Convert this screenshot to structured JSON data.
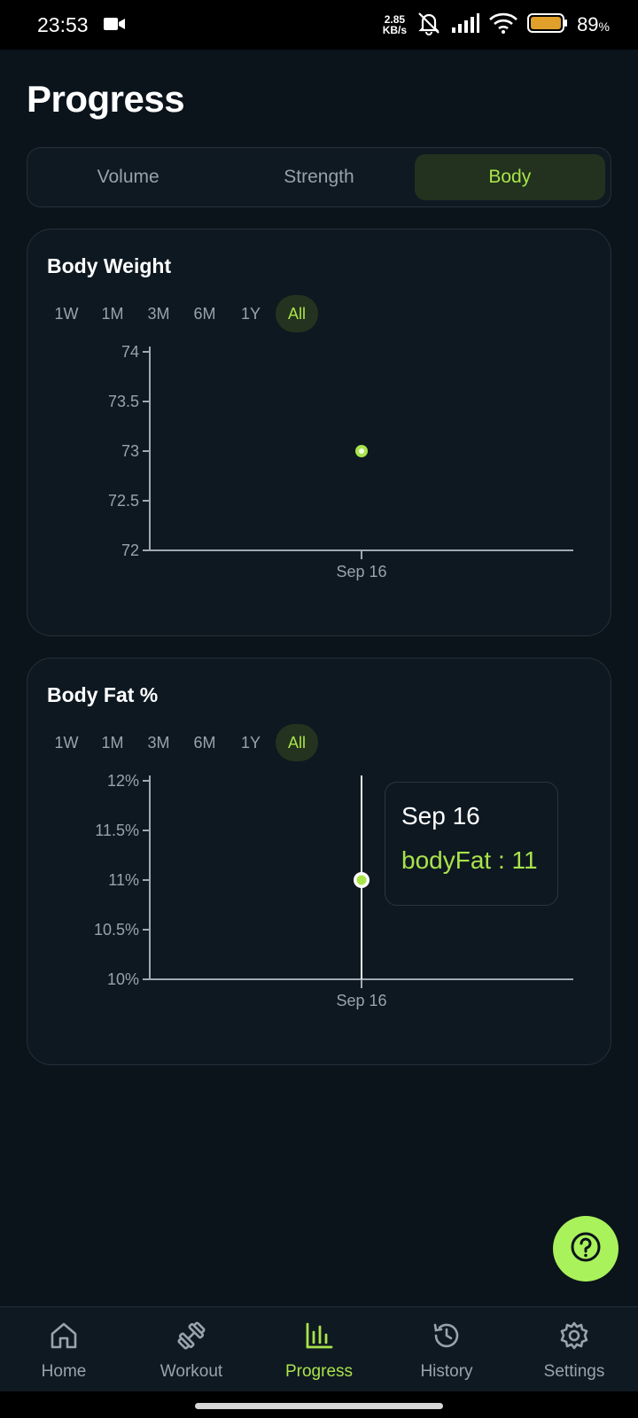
{
  "status_bar": {
    "time": "23:53",
    "net_speed_value": "2.85",
    "net_speed_unit": "KB/s",
    "battery_percent": "89",
    "percent_sign": "%",
    "icons": [
      "video-camera-icon",
      "mute-bell-icon",
      "signal-icon",
      "wifi-icon",
      "battery-icon"
    ]
  },
  "page": {
    "title": "Progress"
  },
  "tabs": [
    {
      "label": "Volume",
      "active": false
    },
    {
      "label": "Strength",
      "active": false
    },
    {
      "label": "Body",
      "active": true
    }
  ],
  "ranges": [
    "1W",
    "1M",
    "3M",
    "6M",
    "1Y",
    "All"
  ],
  "active_range": "All",
  "cards": {
    "weight_title": "Body Weight",
    "fat_title": "Body Fat %"
  },
  "tooltip": {
    "date": "Sep 16",
    "text": "bodyFat : 11"
  },
  "chart_data": [
    {
      "type": "scatter",
      "title": "Body Weight",
      "x": [
        "Sep 16"
      ],
      "y": [
        73
      ],
      "yticks": [
        "74",
        "73.5",
        "73",
        "72.5",
        "72"
      ],
      "ytick_values": [
        74,
        73.5,
        73,
        72.5,
        72
      ],
      "ylim": [
        72,
        74
      ]
    },
    {
      "type": "scatter",
      "title": "Body Fat %",
      "x": [
        "Sep 16"
      ],
      "y": [
        11
      ],
      "yticks": [
        "12%",
        "11.5%",
        "11%",
        "10.5%",
        "10%"
      ],
      "ytick_values": [
        12,
        11.5,
        11,
        10.5,
        10
      ],
      "ylim": [
        10,
        12
      ]
    }
  ],
  "colors": {
    "accent": "#a9e34b",
    "background": "#0b131b",
    "card": "#0e1821",
    "axis": "#a0a9b2"
  },
  "bottom_nav": [
    {
      "label": "Home",
      "icon": "home-icon",
      "active": false
    },
    {
      "label": "Workout",
      "icon": "dumbbell-icon",
      "active": false
    },
    {
      "label": "Progress",
      "icon": "bar-chart-icon",
      "active": true
    },
    {
      "label": "History",
      "icon": "history-icon",
      "active": false
    },
    {
      "label": "Settings",
      "icon": "gear-icon",
      "active": false
    }
  ]
}
